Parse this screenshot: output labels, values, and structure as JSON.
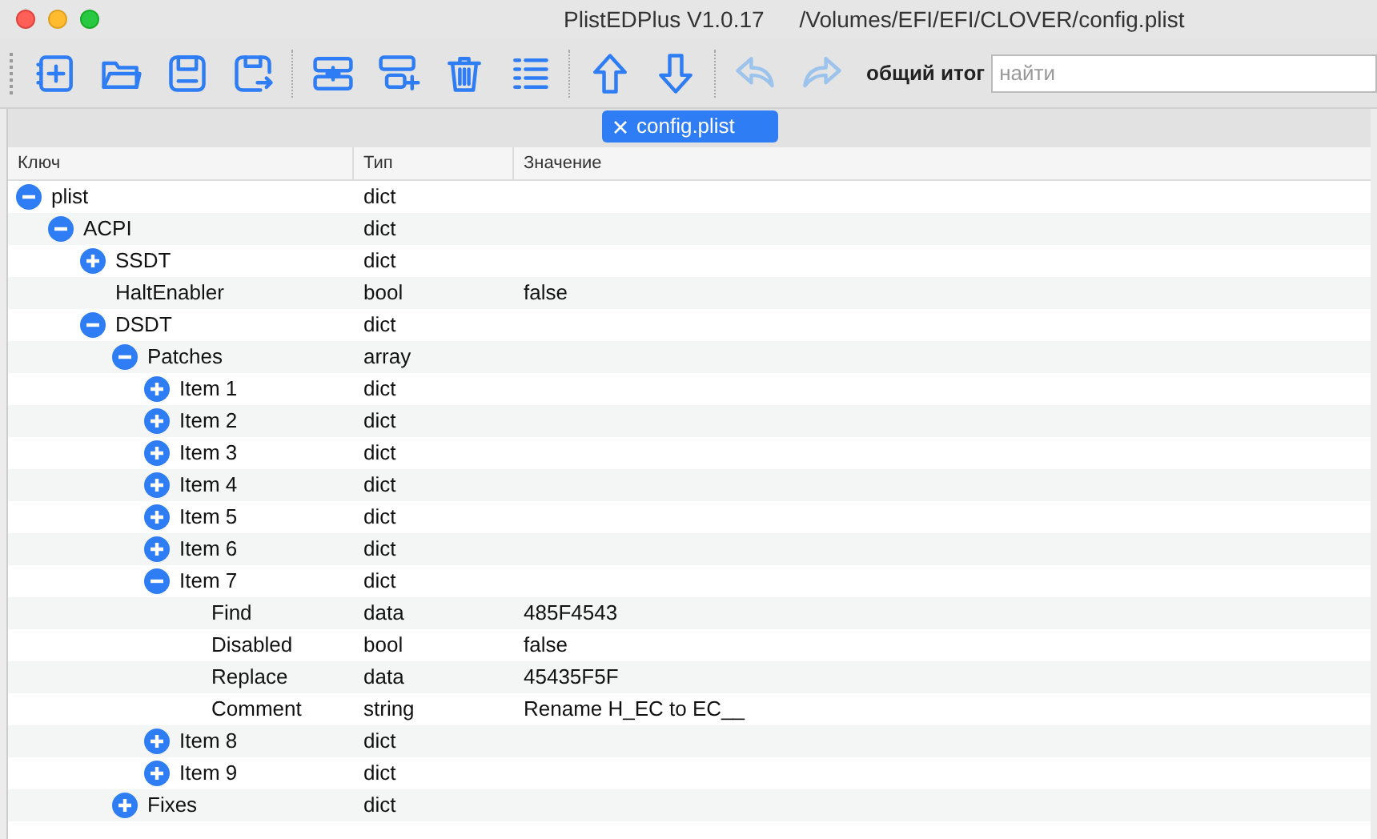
{
  "window": {
    "title": "PlistEDPlus V1.0.17",
    "path": "/Volumes/EFI/EFI/CLOVER/config.plist"
  },
  "toolbar": {
    "groups": [
      [
        {
          "kind": "new",
          "disabled": false
        },
        {
          "kind": "open",
          "disabled": false
        },
        {
          "kind": "save",
          "disabled": false
        },
        {
          "kind": "saveas",
          "disabled": false
        }
      ],
      [
        {
          "kind": "add",
          "disabled": false
        },
        {
          "kind": "addchild",
          "disabled": false
        },
        {
          "kind": "delete",
          "disabled": false
        },
        {
          "kind": "sort",
          "disabled": false
        }
      ],
      [
        {
          "kind": "up",
          "disabled": false
        },
        {
          "kind": "down",
          "disabled": false
        }
      ],
      [
        {
          "kind": "undo",
          "disabled": true
        },
        {
          "kind": "redo",
          "disabled": true
        }
      ]
    ],
    "search_label": "общий итог",
    "search": {
      "placeholder": "найти"
    }
  },
  "tabs": [
    {
      "label": "config.plist",
      "selected": true
    }
  ],
  "table": {
    "columns": [
      "Ключ",
      "Тип",
      "Значение"
    ],
    "rows": [
      {
        "key": "plist",
        "type": "dict",
        "expanded": true,
        "children": [
          {
            "key": "ACPI",
            "type": "dict",
            "expanded": true,
            "children": [
              {
                "key": "SSDT",
                "type": "dict",
                "expanded": false
              },
              {
                "key": "HaltEnabler",
                "type": "bool",
                "value": "false"
              },
              {
                "key": "DSDT",
                "type": "dict",
                "expanded": true,
                "children": [
                  {
                    "key": "Patches",
                    "type": "array",
                    "expanded": true,
                    "children": [
                      {
                        "key": "Item 1",
                        "type": "dict",
                        "expanded": false
                      },
                      {
                        "key": "Item 2",
                        "type": "dict",
                        "expanded": false
                      },
                      {
                        "key": "Item 3",
                        "type": "dict",
                        "expanded": false
                      },
                      {
                        "key": "Item 4",
                        "type": "dict",
                        "expanded": false
                      },
                      {
                        "key": "Item 5",
                        "type": "dict",
                        "expanded": false
                      },
                      {
                        "key": "Item 6",
                        "type": "dict",
                        "expanded": false
                      },
                      {
                        "key": "Item 7",
                        "type": "dict",
                        "expanded": true,
                        "children": [
                          {
                            "key": "Find",
                            "type": "data",
                            "value": "485F4543"
                          },
                          {
                            "key": "Disabled",
                            "type": "bool",
                            "value": "false"
                          },
                          {
                            "key": "Replace",
                            "type": "data",
                            "value": "45435F5F"
                          },
                          {
                            "key": "Comment",
                            "type": "string",
                            "value": "Rename H_EC to EC__"
                          }
                        ]
                      },
                      {
                        "key": "Item 8",
                        "type": "dict",
                        "expanded": false
                      },
                      {
                        "key": "Item 9",
                        "type": "dict",
                        "expanded": false
                      }
                    ]
                  },
                  {
                    "key": "Fixes",
                    "type": "dict",
                    "expanded": false
                  }
                ]
              }
            ]
          }
        ]
      }
    ]
  }
}
